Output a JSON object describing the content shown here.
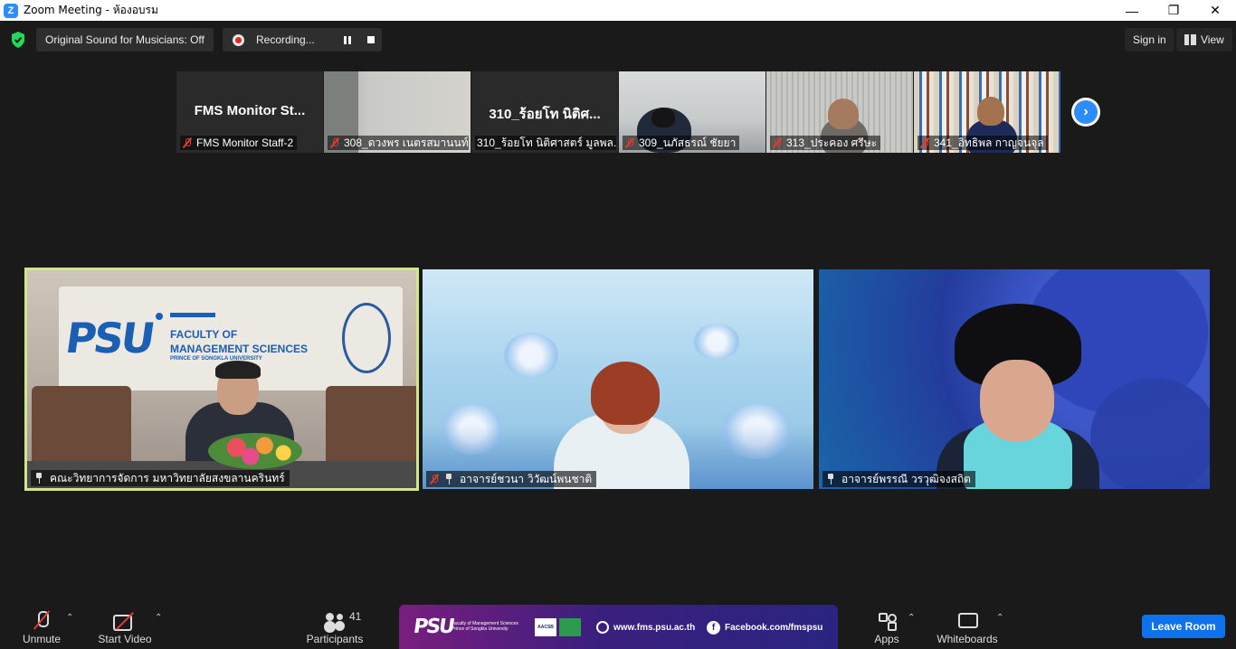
{
  "window": {
    "title": "Zoom Meeting - ห้องอบรม",
    "logo_letter": "Z"
  },
  "topbar": {
    "original_sound": "Original Sound for Musicians: Off",
    "recording": "Recording...",
    "sign_in": "Sign in",
    "view": "View"
  },
  "thumbnails": [
    {
      "big_name": "FMS Monitor St...",
      "label": "FMS Monitor Staff-2",
      "video": false
    },
    {
      "big_name": "",
      "label": "308_ดวงพร เนตรสมานนท์",
      "video": true
    },
    {
      "big_name": "310_ร้อยโท นิติศ...",
      "label": "310_ร้อยโท นิติศาสตร์ มูลพล...",
      "video": false
    },
    {
      "big_name": "",
      "label": "309_นภัสธรณ์ ชัยยา",
      "video": true
    },
    {
      "big_name": "",
      "label": "313_ประคอง ศรีษะ",
      "video": true
    },
    {
      "big_name": "",
      "label": "341_อิทธิพล กาญจนจุล",
      "video": true
    }
  ],
  "tiles": [
    {
      "label": "คณะวิทยาการจัดการ มหาวิทยาลัยสงขลานครินทร์",
      "active_speaker": true
    },
    {
      "label": "อาจารย์ชวนา วิวัฒน์พนชาติ",
      "active_speaker": false
    },
    {
      "label": "อาจารย์พรรณี วรวุฒิจงสถิต",
      "active_speaker": false
    }
  ],
  "toolbar": {
    "unmute": "Unmute",
    "start_video": "Start Video",
    "participants": "Participants",
    "participants_count": "41",
    "apps": "Apps",
    "whiteboards": "Whiteboards",
    "leave_room": "Leave Room"
  },
  "banner": {
    "logo": "PSU",
    "faculty_line1": "Faculty of Management Sciences",
    "faculty_line2": "Prince of Songkla University",
    "aacsb": "AACSB",
    "website": "www.fms.psu.ac.th",
    "facebook": "Facebook.com/fmspsu"
  },
  "colors": {
    "accent": "#2d8cff",
    "leave_button": "#0e72ed",
    "active_speaker_border": "#cfe68a",
    "muted_red": "#e53935"
  }
}
